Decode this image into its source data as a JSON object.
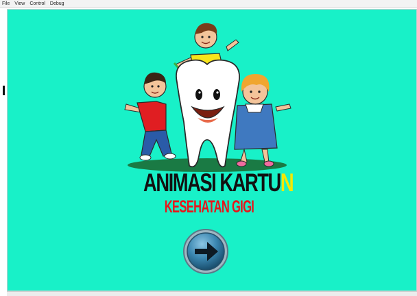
{
  "menu": {
    "file": "File",
    "view": "View",
    "control": "Control",
    "debug": "Debug"
  },
  "title": {
    "main": "ANIMASI KARTU",
    "main_last": "N",
    "sub": "KESEHATAN GIGI"
  },
  "icons": {
    "next": "arrow-right-icon"
  },
  "colors": {
    "background": "#18f1c8",
    "title_main": "#111111",
    "title_accent": "#f4e800",
    "subtitle": "#e8151a",
    "button": "#2b6e92"
  }
}
